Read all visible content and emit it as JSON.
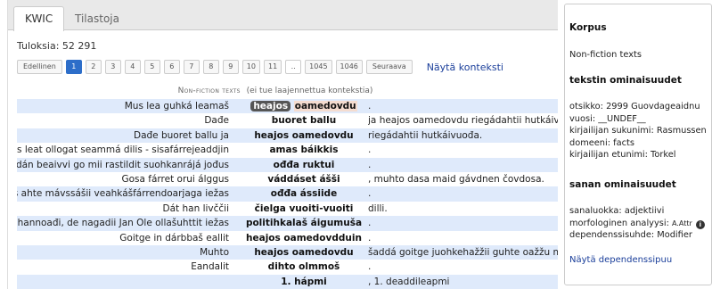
{
  "tabs": [
    {
      "label": "KWIC",
      "active": true
    },
    {
      "label": "Tilastoja",
      "active": false
    }
  ],
  "hits": "Tuloksia: 52 291",
  "pager": {
    "prev": "Edellinen",
    "pages": [
      "1",
      "2",
      "3",
      "4",
      "5",
      "6",
      "7",
      "8",
      "9",
      "10",
      "11"
    ],
    "current": "1",
    "gap": "..",
    "tail_pages": [
      "1045",
      "1046"
    ],
    "next": "Seuraava"
  },
  "context_link": "Näytä konteksti",
  "corpus_header": {
    "name": "Non-fiction texts",
    "note": "(ei tue laajennettua kontekstia)"
  },
  "rows": [
    {
      "left": "Mus lea guhká leamaš",
      "kw_a": "heajos",
      "kw_b": "oamedovdu",
      "right": "."
    },
    {
      "left": "Dađe",
      "kw": "buoret ballu",
      "right": "ja heajos oamedovdu riegádahtii hutkáivuođa."
    },
    {
      "left": "Dađe buoret ballu ja",
      "kw": "heajos oamedovdu",
      "right": "riegádahtii hutkáivuođa."
    },
    {
      "left": "Sámesearvi ságadoalli Mika Kunnus leat ollogat seammá dilis - sisafárrejeaddjin",
      "kw": "amas báikkis",
      "right": "."
    },
    {
      "left": "Sáhtán beaivvi dáinna ja muhtumin sáhtán ges dán beaivvi go mii rastildit suohkanrájá jođus",
      "kw": "ođđa ruktui",
      "right": "."
    },
    {
      "left": "Gosa fárret orui álggus",
      "kw": "váddáset ášši",
      "right": ", muhto dasa maid gávdnen čovdosa."
    },
    {
      "left": "Dán suohkanis ledje dávjá ollu olbmot go mii bođiimet, ja bádus ahte mávssášii veahkášfárrendoarjaga iežas",
      "kw": "ođđa ássiide",
      "right": "."
    },
    {
      "left": "Dát han livččii",
      "kw": "čielga vuoiti-vuoiti",
      "right": "dilli."
    },
    {
      "left": "Dat lea guovllu ovddidanprošeakta mii lea ođihannoađi, de nagadii Jan Ole ollašuhttit iežas",
      "kw": "politihkalaš áigumuša",
      "right": "."
    },
    {
      "left": "Goitge in dárbbaš eallit",
      "kw": "heajos oamedovdduin",
      "right": "."
    },
    {
      "left": "Muhto",
      "kw": "heajos oamedovdu",
      "right": "šaddá goitge juohkehažžii guhte oažžu máksat eanet."
    },
    {
      "left": "Eandalit",
      "kw": "dihto olmmoš",
      "right": "."
    },
    {
      "left": "",
      "kw": "1. hápmi",
      "right": ", 1. deaddileapmi"
    }
  ],
  "sidebar": {
    "corpus_heading": "Korpus",
    "corpus_name": "Non-fiction texts",
    "text_attr_heading": "tekstin ominaisuudet",
    "text_attrs": [
      "otsikko: 2999 Guovdageaidnu",
      "vuosi: __UNDEF__",
      "kirjailijan sukunimi: Rasmussen",
      "domeeni: facts",
      "kirjailijan etunimi: Torkel"
    ],
    "word_attr_heading": "sanan ominaisuudet",
    "word_attrs": {
      "pos": "sanaluokka: adjektiivi",
      "morph_label": "morfologinen analyysi: ",
      "morph_value": "A.Attr",
      "dep": "dependenssisuhde: Modifier"
    },
    "info_icon": "info-icon",
    "dep_link": "Näytä dependenssipuu"
  },
  "colors": {
    "accent": "#2d6ec9",
    "link": "#1a3e9a",
    "row_stripe": "#dfeafb",
    "highlight": "#555555",
    "highlight_secondary": "#f4dcd0"
  }
}
